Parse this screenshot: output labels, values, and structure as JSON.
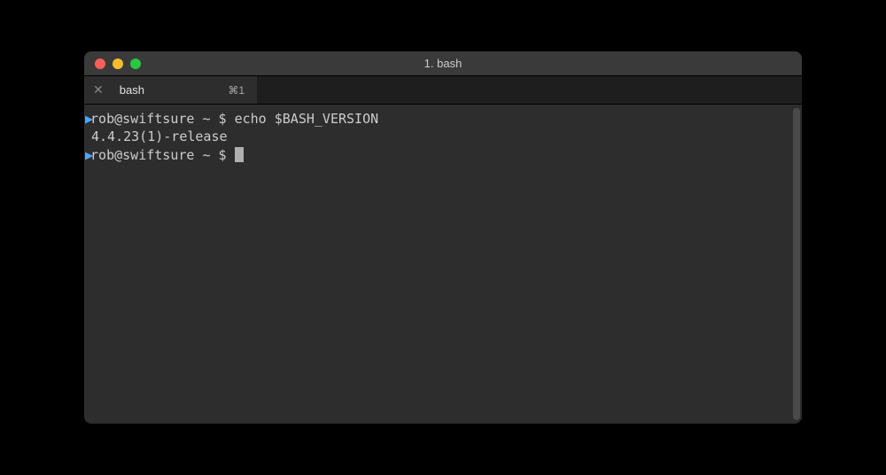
{
  "window": {
    "title": "1. bash"
  },
  "tab": {
    "label": "bash",
    "shortcut": "⌘1",
    "close_symbol": "✕"
  },
  "terminal": {
    "lines": [
      {
        "arrow": "▶",
        "user_host": "rob@swiftsure",
        "path": "~",
        "dollar": "$",
        "command": "echo $BASH_VERSION"
      }
    ],
    "output": "4.4.23(1)-release",
    "prompt2": {
      "arrow": "▶",
      "user_host": "rob@swiftsure",
      "path": "~",
      "dollar": "$"
    }
  }
}
